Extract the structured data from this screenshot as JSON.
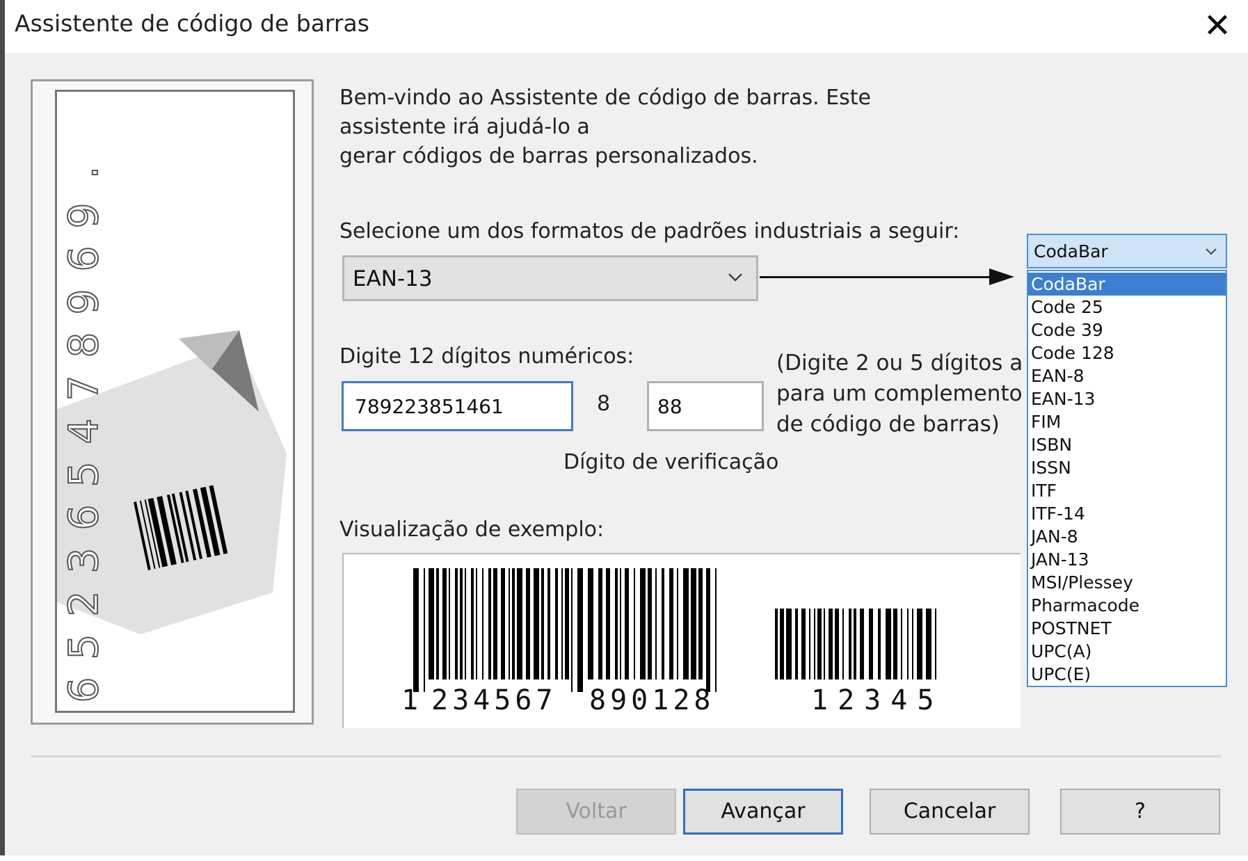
{
  "window": {
    "title": "Assistente de código de barras",
    "close_symbol": "✕"
  },
  "intro": {
    "lines": [
      "Bem-vindo ao Assistente de código de barras. Este",
      "assistente irá ajudá-lo a",
      "gerar códigos de barras personalizados."
    ]
  },
  "format": {
    "label": "Selecione um dos formatos de padrões industriais a seguir:",
    "selected": "EAN-13"
  },
  "digits": {
    "label": "Digite 12 dígitos numéricos:",
    "value": "789223851461",
    "check_digit": "8",
    "check_caption": "Dígito de verificação",
    "addon_value": "88",
    "addon_hint": [
      "(Digite 2 ou 5 dígitos a",
      "para um complemento",
      "de código de barras)"
    ]
  },
  "preview": {
    "label": "Visualização de exemplo:",
    "main_digits": [
      "1",
      "234567",
      "890128"
    ],
    "addon_digits": "12345"
  },
  "side_image": {
    "digits": [
      "6",
      "5",
      "2",
      "3",
      "6",
      "5",
      "4",
      "7",
      "8",
      "9",
      "6",
      "9",
      "."
    ]
  },
  "dropdown": {
    "current": "CodaBar",
    "options": [
      "CodaBar",
      "Code 25",
      "Code 39",
      "Code 128",
      "EAN-8",
      "EAN-13",
      "FIM",
      "ISBN",
      "ISSN",
      "ITF",
      "ITF-14",
      "JAN-8",
      "JAN-13",
      "MSI/Plessey",
      "Pharmacode",
      "POSTNET",
      "UPC(A)",
      "UPC(E)"
    ],
    "selected_index": 0
  },
  "buttons": {
    "back": "Voltar",
    "next": "Avançar",
    "cancel": "Cancelar",
    "help": "?"
  },
  "colors": {
    "accent": "#3c7fd0",
    "focus_border": "#3d7ad6",
    "dialog_bg": "#f0f0f0"
  }
}
